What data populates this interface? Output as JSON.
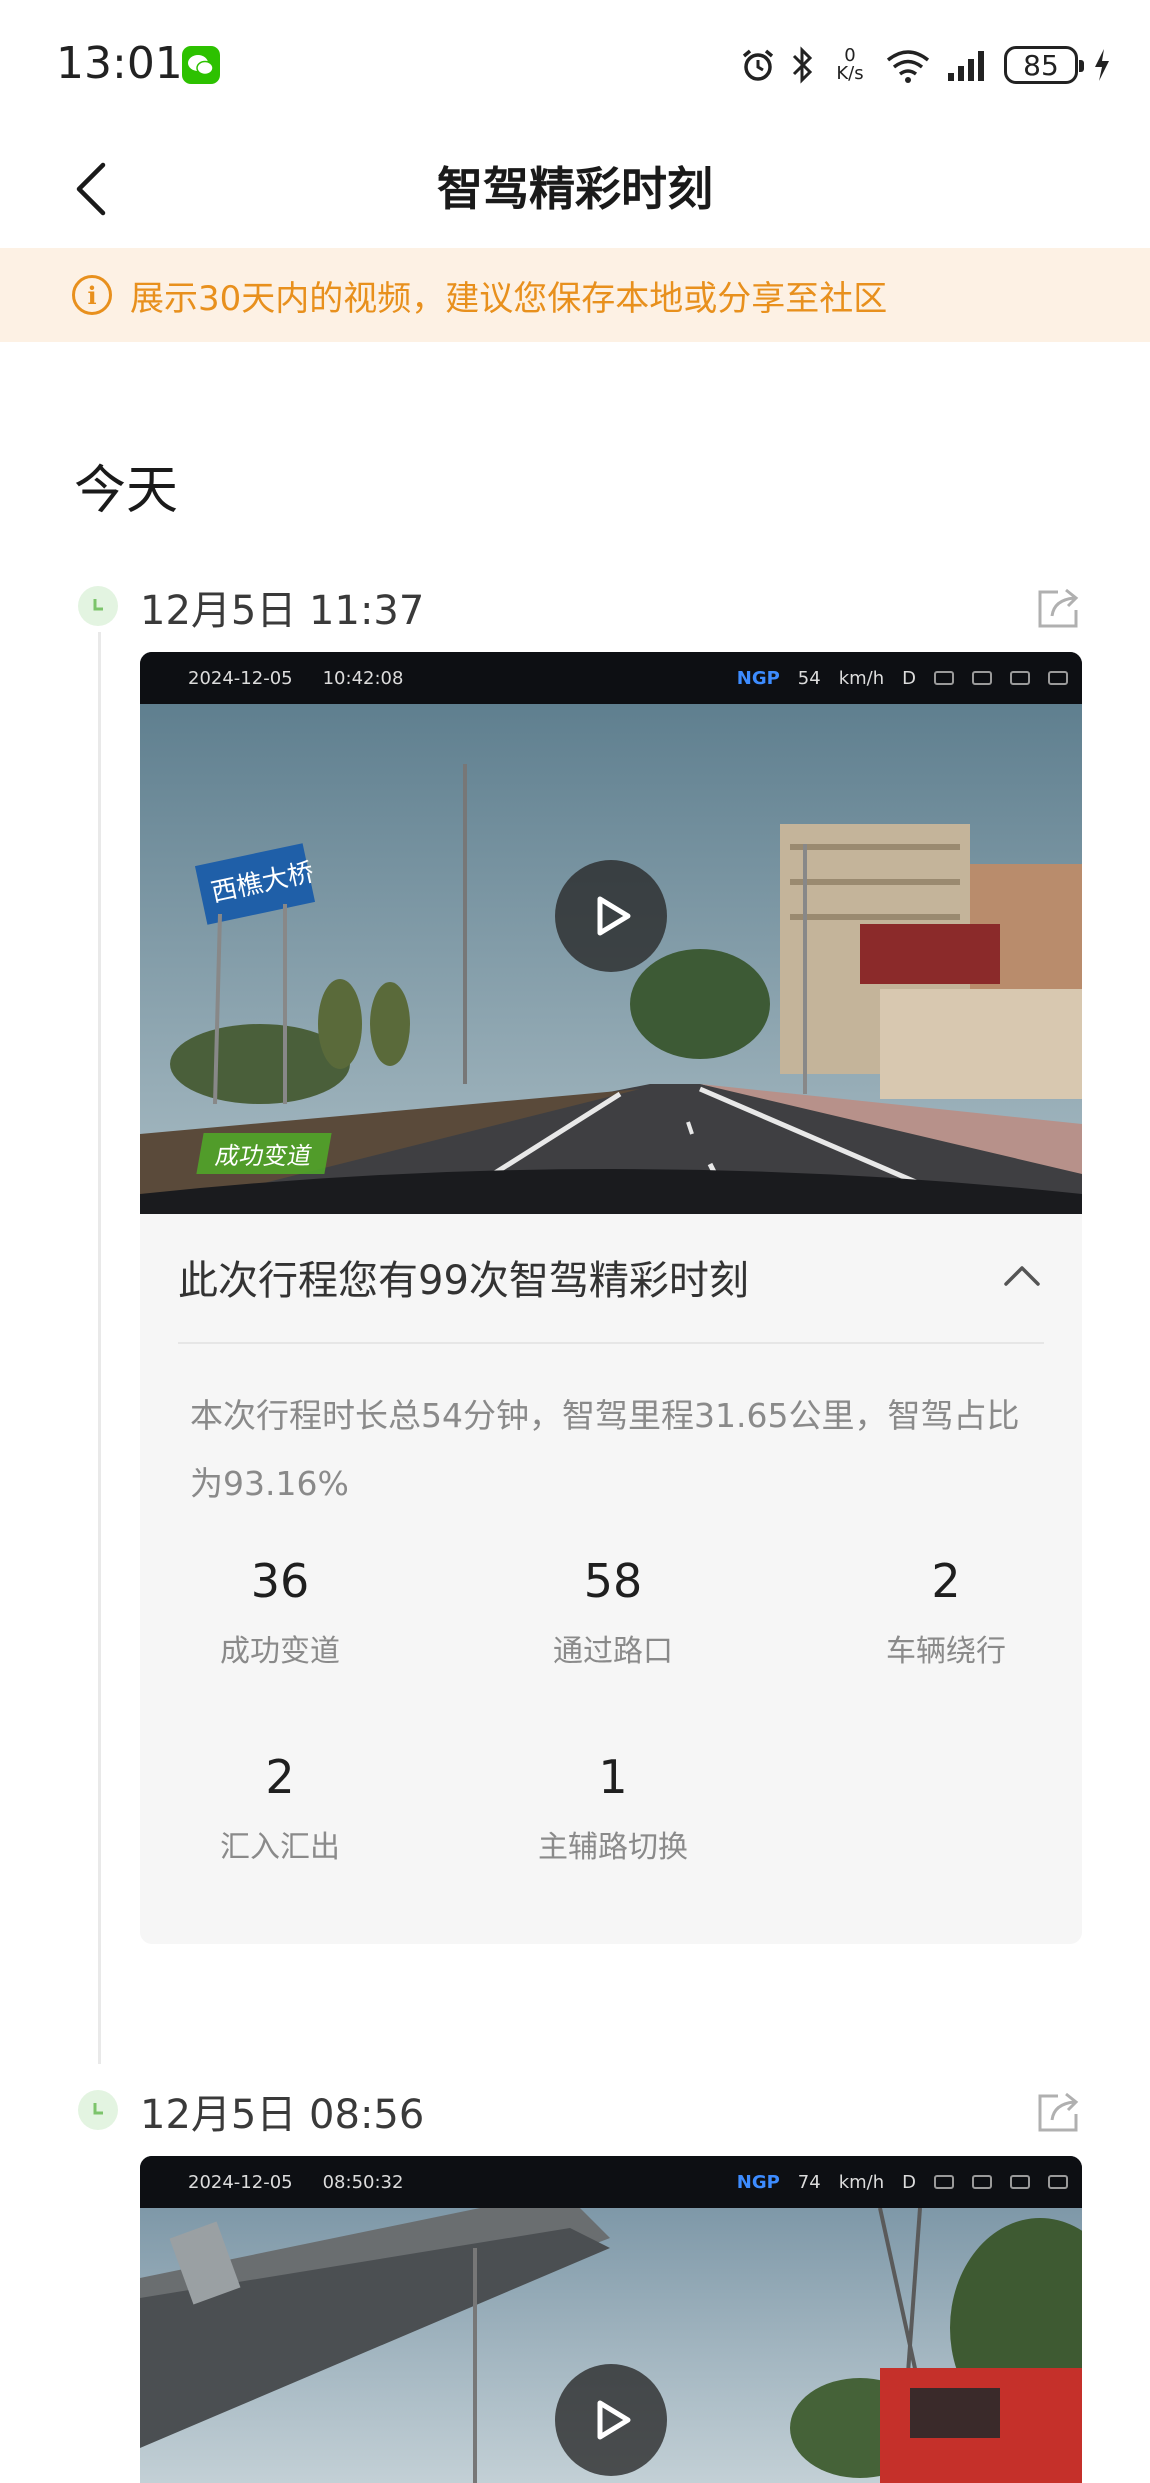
{
  "status_bar": {
    "time": "13:01",
    "net_speed_value": "0",
    "net_speed_unit": "K/s",
    "battery": "85",
    "icons": [
      "wechat-icon",
      "alarm-icon",
      "bluetooth-icon",
      "wifi-icon",
      "signal-icon",
      "charging-icon"
    ]
  },
  "header": {
    "title": "智驾精彩时刻"
  },
  "notice": {
    "text": "展示30天内的视频，建议您保存本地或分享至社区"
  },
  "section": {
    "title": "今天"
  },
  "trips": [
    {
      "time": "12月5日 11:37",
      "video": {
        "hud_date": "2024-12-05",
        "hud_time": "10:42:08",
        "hud_mode": "NGP",
        "hud_speed": "54",
        "hud_unit": "km/h",
        "hud_gear": "D",
        "sign_text": "西樵大桥",
        "badge": "成功变道"
      },
      "summary": {
        "headline": "此次行程您有99次智驾精彩时刻",
        "description": "本次行程时长总54分钟，智驾里程31.65公里，智驾占比为93.16%",
        "stats": [
          {
            "value": "36",
            "label": "成功变道"
          },
          {
            "value": "58",
            "label": "通过路口"
          },
          {
            "value": "2",
            "label": "车辆绕行"
          },
          {
            "value": "2",
            "label": "汇入汇出"
          },
          {
            "value": "1",
            "label": "主辅路切换"
          }
        ]
      }
    },
    {
      "time": "12月5日 08:56",
      "video": {
        "hud_date": "2024-12-05",
        "hud_time": "08:50:32",
        "hud_mode": "NGP",
        "hud_speed": "74",
        "hud_unit": "km/h",
        "hud_gear": "D"
      }
    }
  ],
  "colors": {
    "accent_orange": "#e8901d",
    "notice_bg": "#fdf1e4",
    "timeline_green": "#7cc46b",
    "card_bg": "#f6f6f6"
  }
}
